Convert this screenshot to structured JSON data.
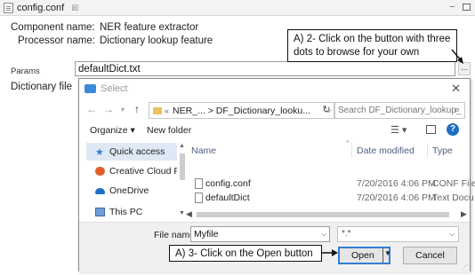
{
  "editor": {
    "tab_title": "config.conf",
    "tab_close_glyph": "☒",
    "minimize_glyph": "–",
    "component_name_label": "Component name:",
    "component_name_value": "NER feature extractor",
    "processor_name_label": "Processor name:",
    "processor_name_value": "Dictionary lookup feature",
    "params_label": "Params",
    "dictionary_file_label": "Dictionary file",
    "dictionary_file_value": "defaultDict.txt",
    "dots_button_label": "..."
  },
  "callouts": {
    "browse": "A) 2- Click on the button with three dots to browse for your own",
    "open": "A) 3- Click on the Open button"
  },
  "dialog": {
    "title": "Select",
    "close_glyph": "✕",
    "address": {
      "prefix": "«",
      "path": "NER_... > DF_Dictionary_looku...",
      "chevron": "⌵",
      "refresh_glyph": "↻"
    },
    "search_placeholder": "Search DF_Dictionary_lookup_...",
    "toolbar": {
      "organize": "Organize ▾",
      "new_folder": "New folder",
      "view_glyph": "☰ ▾",
      "help_glyph": "?"
    },
    "nav_items": [
      {
        "label": "Quick access",
        "selected": true
      },
      {
        "label": "Creative Cloud File",
        "selected": false
      },
      {
        "label": "OneDrive",
        "selected": false
      },
      {
        "label": "This PC",
        "selected": false
      }
    ],
    "columns": {
      "name": "Name",
      "date": "Date modified",
      "type": "Type"
    },
    "files": [
      {
        "name": "config.conf",
        "date": "7/20/2016 4:06 PM",
        "type": "CONF File"
      },
      {
        "name": "defaultDict",
        "date": "7/20/2016 4:06 PM",
        "type": "Text Docu"
      }
    ],
    "file_name_label": "File name:",
    "file_name_value": "Myfile",
    "filter_value": "*.*",
    "open_label": "Open",
    "cancel_label": "Cancel"
  },
  "colors": {
    "selected_nav": "#dfe9f5",
    "primary_border": "#2f7fd3",
    "help_icon": "#1e6fbf"
  }
}
